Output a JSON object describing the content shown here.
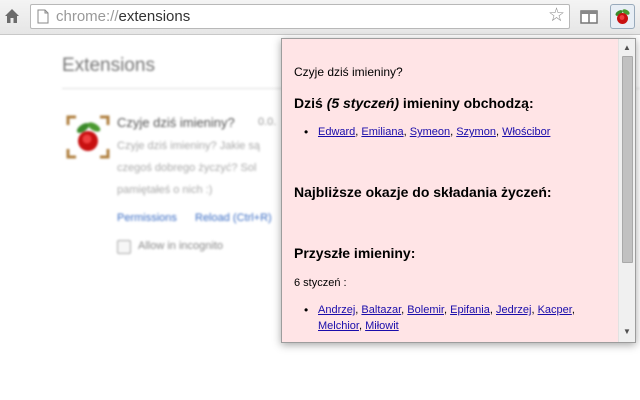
{
  "browser": {
    "url_scheme": "chrome://",
    "url_path": "extensions"
  },
  "background": {
    "page_title": "Extensions",
    "extension": {
      "name": "Czyje dziś imieniny?",
      "version": "0.0.",
      "description_lines": [
        "Czyje dziś imieniny? Jakie są",
        "czegoś dobrego życzyć? Sol",
        "pamiętałeś o nich :)"
      ],
      "permissions_label": "Permissions",
      "reload_label": "Reload (Ctrl+R)",
      "incognito_label": "Allow in incognito"
    }
  },
  "popup": {
    "title": "Czyje dziś imieniny?",
    "today_heading_prefix": "Dziś ",
    "today_date": "(5 styczeń)",
    "today_heading_suffix": " imieniny obchodzą:",
    "today_names": [
      "Edward",
      "Emiliana",
      "Symeon",
      "Szymon",
      "Włościbor"
    ],
    "occasions_heading": "Najbliższe okazje do składania życzeń:",
    "upcoming_heading": "Przyszłe imieniny:",
    "upcoming_date_label": "6 styczeń :",
    "upcoming_names": [
      "Andrzej",
      "Baltazar",
      "Bolemir",
      "Epifania",
      "Jedrzej",
      "Kacper",
      "Melchior",
      "Miłowit"
    ]
  },
  "colors": {
    "popup_background": "#ffe4e6",
    "link": "#1a0dab"
  }
}
